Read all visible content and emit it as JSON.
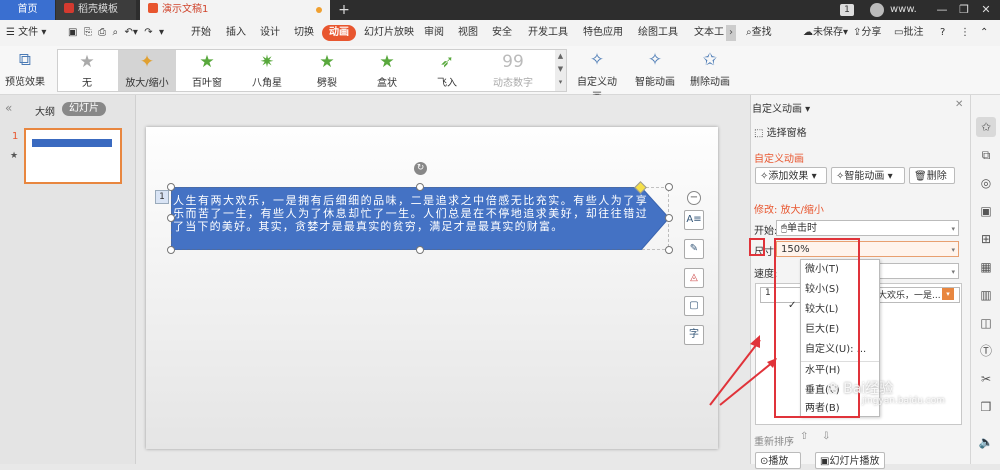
{
  "tabs": [
    {
      "label": "首页"
    },
    {
      "label": "稻壳模板"
    },
    {
      "label": "演示文稿1"
    }
  ],
  "titlebar": {
    "page_badge": "1",
    "user": "www.",
    "plus": "+",
    "minimize": "—",
    "restore": "❐",
    "close": "✕"
  },
  "menu": {
    "file": "文件",
    "items": [
      "开始",
      "插入",
      "设计",
      "切换",
      "动画",
      "幻灯片放映",
      "审阅",
      "视图",
      "安全",
      "开发工具",
      "特色应用",
      "绘图工具",
      "文本工"
    ],
    "search": "查找",
    "unsaved": "未保存",
    "share": "分享",
    "comment": "批注",
    "help": "?"
  },
  "ribbon": {
    "preview": "预览效果",
    "gallery": [
      {
        "label": "无",
        "icon": "★"
      },
      {
        "label": "放大/缩小",
        "icon": "✦"
      },
      {
        "label": "百叶窗",
        "icon": "★"
      },
      {
        "label": "八角星",
        "icon": "✷"
      },
      {
        "label": "劈裂",
        "icon": "★"
      },
      {
        "label": "盒状",
        "icon": "★"
      },
      {
        "label": "飞入",
        "icon": "➶"
      },
      {
        "label": "动态数字",
        "icon": "99"
      }
    ],
    "custom_anim": "自定义动画",
    "smart_anim": "智能动画",
    "delete_anim": "删除动画"
  },
  "left_panel": {
    "outline": "大纲",
    "slides": "幻灯片",
    "slide_number": "1"
  },
  "slide": {
    "anim_number": "1",
    "text": "人生有两大欢乐，一是拥有后细细的品味，二是追求之中倍感无比充实。有些人为了享乐而苦了一生，有些人为了休息却忙了一生。人们总是在不停地追求美好，却往往错过了当下的美好。其实，贪婪才是最真实的贫穷，满足才是最真实的财富。",
    "shape_color": "#4472c4"
  },
  "pane": {
    "title": "自定义动画",
    "select_pane": "选择窗格",
    "section_title": "自定义动画",
    "add_effect": "添加效果",
    "smart_anim": "智能动画",
    "delete": "删除",
    "modify": "修改: 放大/缩小",
    "start_label": "开始:",
    "start_value": "单击时",
    "size_label": "尺寸:",
    "size_value": "150%",
    "speed_label": "速度:",
    "list_item": "大欢乐，一是...",
    "reorder": "重新排序",
    "play": "播放",
    "slideshow": "幻灯片播放"
  },
  "size_menu": {
    "options": [
      "微小(T)",
      "较小(S)",
      "较大(L)",
      "巨大(E)",
      "自定义(U): ...",
      "水平(H)",
      "垂直(V)",
      "两者(B)"
    ],
    "checked_index": 2
  },
  "colors": {
    "accent": "#e8562f",
    "annotation": "#e0333a"
  }
}
